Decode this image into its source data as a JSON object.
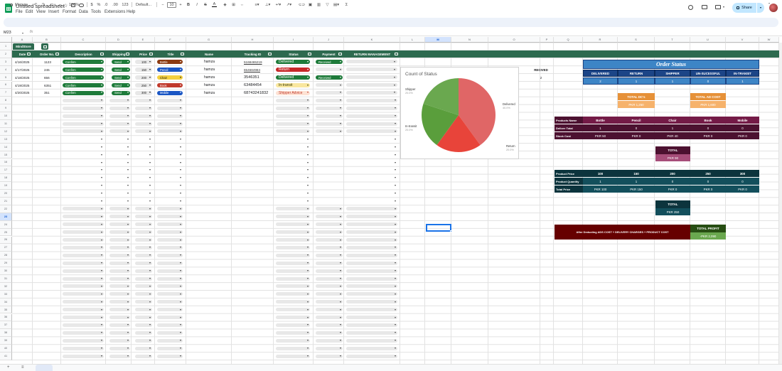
{
  "doc": {
    "title": "Untitled spreadsheet",
    "menus": [
      "File",
      "Edit",
      "View",
      "Insert",
      "Format",
      "Data",
      "Tools",
      "Extensions",
      "Help"
    ],
    "share": "Share"
  },
  "toolbar": {
    "menus": "Menus",
    "zoom": "100%",
    "dollar": "$",
    "percent": "%",
    "dec_less": ".0",
    "dec_more": ".00",
    "format_123": "123",
    "font": "Default...",
    "font_size": "10",
    "minus": "−",
    "plus": "+",
    "bold": "B",
    "italic": "I",
    "strike": "S",
    "text_a": "A",
    "sigma": "Σ"
  },
  "formula": {
    "cell_ref": "M23",
    "fx": "fx"
  },
  "columns": [
    "A",
    "B",
    "C",
    "D",
    "E",
    "F",
    "G",
    "H",
    "I",
    "J",
    "K",
    "L",
    "M",
    "N",
    "O",
    "P",
    "Q",
    "R",
    "S",
    "T",
    "U",
    "V",
    "W"
  ],
  "selected_col": "M",
  "rows": [
    "1",
    "2",
    "3",
    "4",
    "5",
    "6",
    "7",
    "8",
    "9",
    "10",
    "11",
    "12",
    "13",
    "14",
    "15",
    "16",
    "17",
    "18",
    "19",
    "20",
    "21",
    "22",
    "23",
    "24",
    "25",
    "26",
    "27",
    "28",
    "29",
    "30",
    "31",
    "32",
    "33",
    "34",
    "35",
    "36",
    "37",
    "38",
    "39",
    "40",
    "41"
  ],
  "selected_row": "23",
  "table": {
    "group_label": "MindStore",
    "headers": [
      "Date",
      "Order No.",
      "Description",
      "Shipping",
      "Price",
      "Title",
      "Name",
      "Tracking ID",
      "Status",
      "Payment",
      "RETURN MANAGEMENT"
    ],
    "rows": [
      {
        "date": "4/16/2025",
        "order": "1123",
        "desc": "Confirm",
        "ship": "Send",
        "price": "100",
        "title": "Bottle",
        "name": "hamza",
        "tracking": "5168465219",
        "status": "Delivered",
        "payment": "Received"
      },
      {
        "date": "4/17/2025",
        "order": "245",
        "desc": "Confirm",
        "ship": "Send",
        "price": "150",
        "title": "Pencil",
        "name": "hamza",
        "tracking": "654684984",
        "status": "Return",
        "payment": ""
      },
      {
        "date": "4/18/2025",
        "order": "656",
        "desc": "Confirm",
        "ship": "Send",
        "price": "200",
        "title": "Chair",
        "name": "hamza",
        "tracking": "3546351",
        "status": "Delivered",
        "payment": "Received"
      },
      {
        "date": "4/19/2025",
        "order": "6351",
        "desc": "Confirm",
        "ship": "Send",
        "price": "250",
        "title": "Book",
        "name": "hamza",
        "tracking": "63484454",
        "status": "In-transit",
        "payment": ""
      },
      {
        "date": "4/20/2025",
        "order": "351",
        "desc": "Confirm",
        "ship": "Send",
        "price": "300",
        "title": "Mobile",
        "name": "hamza",
        "tracking": "68743241832",
        "status": "Shipper Advice",
        "payment": ""
      }
    ]
  },
  "chart_data": {
    "type": "pie",
    "title": "Count of Status",
    "categories": [
      "Delivered",
      "Return",
      "In-transit",
      "Shipper"
    ],
    "values": [
      2,
      1,
      1,
      1
    ],
    "labels": [
      "40.0%",
      "20.0%",
      "20.0%",
      "20.0%"
    ],
    "colors": [
      "#e06666",
      "#e8443a",
      "#5a9e3c",
      "#6aa84f"
    ]
  },
  "recived": {
    "label": "RECIVED",
    "value": "2"
  },
  "order_status": {
    "title": "Order Status",
    "headers": [
      "DELIVERED",
      "RETURN",
      "SHIPPER",
      "UN-SUCESSFUL",
      "IN-TRANSIT"
    ],
    "values": [
      "2",
      "1",
      "1",
      "0",
      "1"
    ]
  },
  "dc": {
    "label": "TOTAL DC's",
    "value": "PKR 1,250"
  },
  "ad": {
    "label": "TOTAL AD COST",
    "value": "PKR 1,600"
  },
  "products": {
    "row_labels": [
      "Products Name",
      "Deliver Total",
      "Stock Cost"
    ],
    "names": [
      "Bottle",
      "Pencil",
      "Chair",
      "Book",
      "Mobile"
    ],
    "deliver": [
      "1",
      "0",
      "1",
      "0",
      "0"
    ],
    "stock": [
      "PKR 50",
      "PKR 0",
      "PKR 40",
      "PKR 0",
      "PKR 0"
    ],
    "total_label": "TOTAL",
    "total_value": "PKR 90"
  },
  "prices": {
    "row_labels": [
      "Product Price",
      "Product Quantity",
      "Total Price"
    ],
    "price": [
      "100",
      "150",
      "200",
      "250",
      "300"
    ],
    "qty": [
      "1",
      "1",
      "0",
      "0",
      "0"
    ],
    "total": [
      "PKR 100",
      "PKR 150",
      "PKR 0",
      "PKR 0",
      "PKR 0"
    ],
    "total_label": "TOTAL",
    "total_value": "PKR 250"
  },
  "profit": {
    "note": "After Deducting ADS COST + DELIVERY CHARGES + PRODUCT COST",
    "label": "TOTAL PROFIT",
    "value": "-PKR 2,090"
  }
}
